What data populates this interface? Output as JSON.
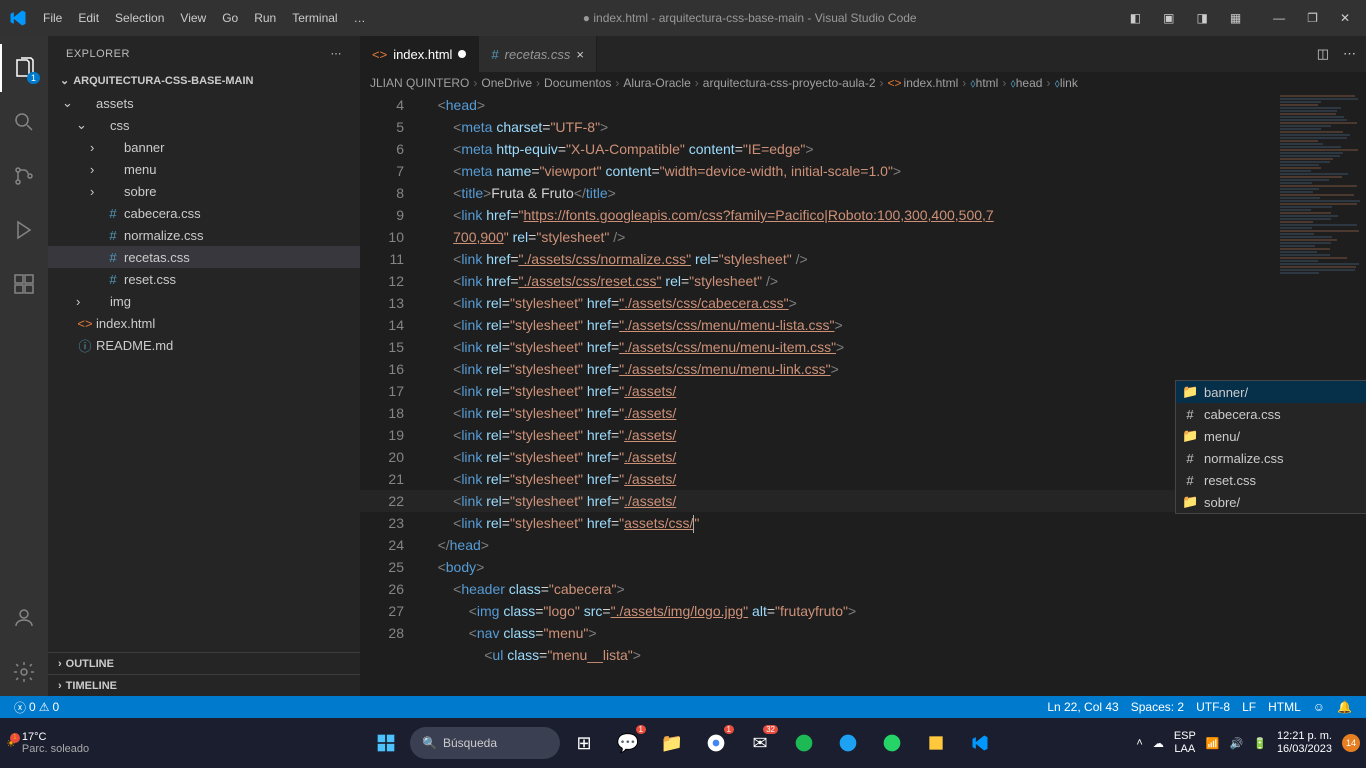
{
  "titlebar": {
    "menus": [
      "File",
      "Edit",
      "Selection",
      "View",
      "Go",
      "Run",
      "Terminal",
      "…"
    ],
    "title": "● index.html - arquitectura-css-base-main - Visual Studio Code"
  },
  "sidebar": {
    "header": "EXPLORER",
    "project": "ARQUITECTURA-CSS-BASE-MAIN",
    "tree": [
      {
        "name": "assets",
        "depth": 0,
        "type": "folder",
        "open": true
      },
      {
        "name": "css",
        "depth": 1,
        "type": "folder",
        "open": true
      },
      {
        "name": "banner",
        "depth": 2,
        "type": "folder"
      },
      {
        "name": "menu",
        "depth": 2,
        "type": "folder"
      },
      {
        "name": "sobre",
        "depth": 2,
        "type": "folder"
      },
      {
        "name": "cabecera.css",
        "depth": 2,
        "type": "css"
      },
      {
        "name": "normalize.css",
        "depth": 2,
        "type": "css"
      },
      {
        "name": "recetas.css",
        "depth": 2,
        "type": "css",
        "selected": true
      },
      {
        "name": "reset.css",
        "depth": 2,
        "type": "css"
      },
      {
        "name": "img",
        "depth": 1,
        "type": "folder"
      },
      {
        "name": "index.html",
        "depth": 0,
        "type": "html"
      },
      {
        "name": "README.md",
        "depth": 0,
        "type": "md"
      }
    ],
    "outline": "OUTLINE",
    "timeline": "TIMELINE"
  },
  "tabs": [
    {
      "name": "index.html",
      "icon": "html",
      "modified": true,
      "active": true
    },
    {
      "name": "recetas.css",
      "icon": "css",
      "modified": false,
      "active": false
    }
  ],
  "breadcrumb": [
    "JLIAN QUINTERO",
    "OneDrive",
    "Documentos",
    "Alura-Oracle",
    "arquitectura-css-proyecto-aula-2",
    "index.html",
    "html",
    "head",
    "link"
  ],
  "code_lines": [
    4,
    5,
    6,
    7,
    8,
    9,
    10,
    11,
    12,
    13,
    14,
    15,
    16,
    17,
    18,
    19,
    20,
    21,
    22,
    23,
    24,
    25,
    26,
    27,
    28
  ],
  "code_text": {
    "title": "Fruta & Fruto",
    "meta_vp": "width=device-width, initial-scale=1.0",
    "fonts": "https://fonts.googleapis.com/css?family=Pacifico|Roboto:100,300,400,500,700,900",
    "img_src": "./assets/img/logo.jpg",
    "img_alt": "frutayfruto"
  },
  "suggest": [
    {
      "icon": "folder",
      "label": "banner/"
    },
    {
      "icon": "file",
      "label": "cabecera.css"
    },
    {
      "icon": "folder",
      "label": "menu/"
    },
    {
      "icon": "file",
      "label": "normalize.css"
    },
    {
      "icon": "file",
      "label": "reset.css"
    },
    {
      "icon": "folder",
      "label": "sobre/"
    }
  ],
  "statusbar": {
    "errors": "0",
    "warnings": "0",
    "pos": "Ln 22, Col 43",
    "spaces": "Spaces: 2",
    "encoding": "UTF-8",
    "eol": "LF",
    "lang": "HTML"
  },
  "taskbar": {
    "temp": "17°C",
    "weather": "Parc. soleado",
    "search": "Búsqueda",
    "lang1": "ESP",
    "lang2": "LAA",
    "time": "12:21 p. m.",
    "date": "16/03/2023",
    "notif": "14"
  }
}
